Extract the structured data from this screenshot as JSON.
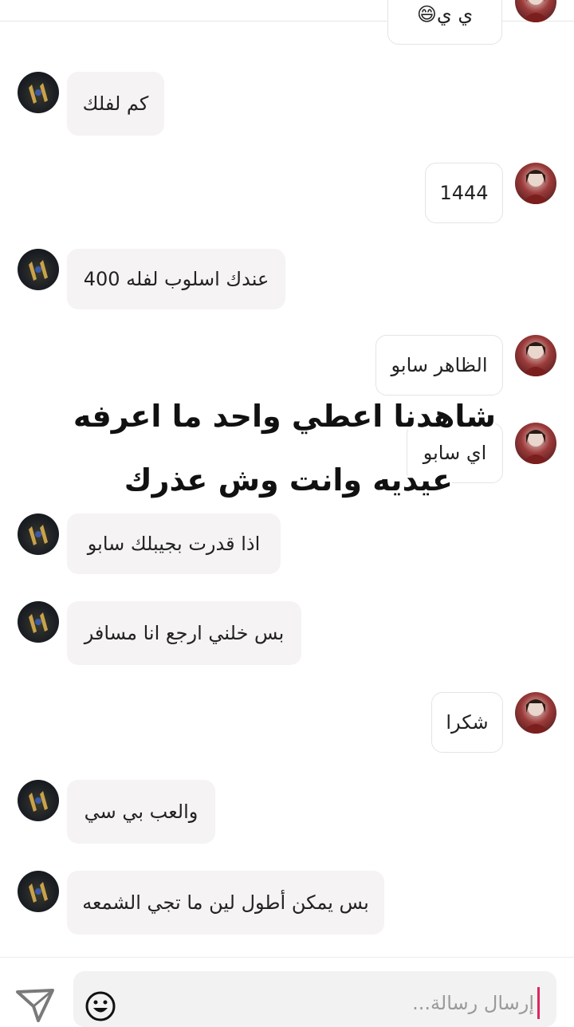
{
  "messages": [
    {
      "side": "out",
      "text": "ي ي😄"
    },
    {
      "side": "in",
      "text": "كم لفلك"
    },
    {
      "side": "out",
      "text": "1444"
    },
    {
      "side": "in",
      "text": "عندك اسلوب لفله 400"
    },
    {
      "side": "out",
      "text": "الظاهر سابو"
    },
    {
      "side": "out",
      "text": "اي سابو"
    },
    {
      "side": "in",
      "text": "اذا قدرت بجيبلك سابو"
    },
    {
      "side": "in",
      "text": "بس خلني ارجع انا مسافر"
    },
    {
      "side": "out",
      "text": "شكرا"
    },
    {
      "side": "in",
      "text": "والعب بي سي"
    },
    {
      "side": "in",
      "text": "بس يمكن أطول لين ما تجي الشمعه"
    }
  ],
  "overlay": {
    "line1": "شاهدنا اعطي واحد ما اعرفه",
    "line2": "عيديه وانت وش عذرك"
  },
  "composer": {
    "placeholder": "إرسال رسالة...",
    "cursor_color": "#e0245e"
  },
  "icons": {
    "send": "send-icon",
    "emoji": "emoji-icon",
    "avatar_other": "avatar-other",
    "avatar_me": "avatar-me"
  }
}
